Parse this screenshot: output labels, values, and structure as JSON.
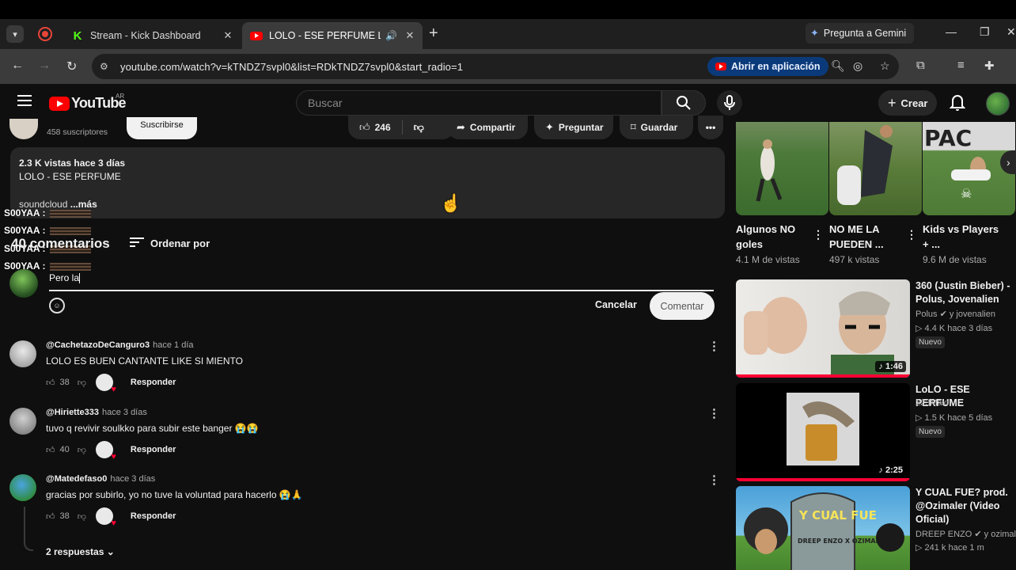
{
  "browser": {
    "tabs": [
      {
        "label": "Stream - Kick Dashboard",
        "active": false
      },
      {
        "label": "LOLO - ESE PERFUME LA SU",
        "active": true
      }
    ],
    "gemini_label": "Pregunta a Gemini",
    "url": "youtube.com/watch?v=kTNDZ7svpl0&list=RDkTNDZ7svpl0&start_radio=1",
    "open_app_label": "Abrir en aplicación"
  },
  "youtube": {
    "logo_text": "YouTube",
    "country_code": "AR",
    "search_placeholder": "Buscar",
    "create_label": "Crear"
  },
  "video": {
    "subscribers": "458 suscriptores",
    "subscribe_label": "Suscribirse",
    "likes": "246",
    "share_label": "Compartir",
    "ask_label": "Preguntar",
    "save_label": "Guardar",
    "description": {
      "meta": "2.3 K vistas  hace 3 días",
      "title": "LOLO - ESE PERFUME",
      "snippet": "soundcloud",
      "more": "...más"
    }
  },
  "chat_overlay": [
    {
      "user": "S00YAA :"
    },
    {
      "user": "S00YAA :"
    },
    {
      "user": "S00YAA :"
    },
    {
      "user": "S00YAA :"
    }
  ],
  "comments": {
    "count_label": "40 comentarios",
    "sort_label": "Ordenar por",
    "draft_text": "Pero la",
    "cancel_label": "Cancelar",
    "submit_label": "Comentar",
    "reply_label": "Responder",
    "items": [
      {
        "author": "@CachetazoDeCanguro3",
        "time": "hace 1 día",
        "text": "LOLO ES BUEN CANTANTE LIKE SI MIENTO",
        "likes": "38",
        "avatar_color": "#cfcfcf"
      },
      {
        "author": "@Hiriette333",
        "time": "hace 3 días",
        "text": "tuvo q revivir soulkko para subir este banger 😭😭",
        "likes": "40",
        "avatar_color": "#9a9a9a"
      },
      {
        "author": "@Matedefaso0",
        "time": "hace 3 días",
        "text": "gracias por subirlo, yo no tuve la voluntad para hacerlo 😭🙏",
        "likes": "38",
        "avatar_color": "#5db36a"
      }
    ],
    "replies_label": "2 respuestas"
  },
  "shorts": [
    {
      "title": "Algunos NO goles",
      "views": "4.1 M de vistas"
    },
    {
      "title": "NO ME LA PUEDEN ...",
      "views": "497 k vistas"
    },
    {
      "title": "Kids vs Players + ...",
      "views": "9.6 M de vistas"
    }
  ],
  "related": [
    {
      "title": "360 (Justin Bieber) - Polus, Jovenalien",
      "channel": "Polus ✔ y jovenalien",
      "stats": "▷ 4.4 K  hace 3 días",
      "badge": "Nuevo",
      "duration": "♪ 1:46"
    },
    {
      "title": "LoLO - ESE PERFUME",
      "channel": "223Maxi",
      "stats": "▷ 1.5 K  hace 5 días",
      "badge": "Nuevo",
      "duration": "♪ 2:25"
    },
    {
      "title": "Y CUAL FUE? prod. @Ozimaler (Video Oficial)",
      "channel": "DREEP ENZO ✔ y ozimal...",
      "stats": "▷ 241 k  hace 1 m",
      "badge": "",
      "duration": ""
    }
  ],
  "thumb_texts": {
    "cual_fue": "Y CUAL FUE",
    "dreep": "DREEP ENZO X OZIMALER"
  }
}
